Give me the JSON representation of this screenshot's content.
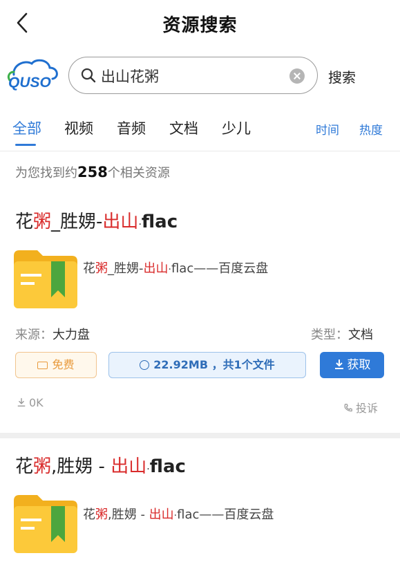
{
  "header": {
    "title": "资源搜索"
  },
  "search": {
    "value": "出山花粥",
    "button": "搜索",
    "logo": "QUSO"
  },
  "tabs": [
    {
      "label": "全部",
      "active": true
    },
    {
      "label": "视频"
    },
    {
      "label": "音频"
    },
    {
      "label": "文档"
    },
    {
      "label": "少儿"
    }
  ],
  "sort": {
    "time": "时间",
    "hot": "热度"
  },
  "results_count": {
    "prefix": "为您找到约",
    "number": "258",
    "suffix": "个相关资源"
  },
  "results": [
    {
      "title_parts": [
        "花",
        "粥",
        "_胜娚-",
        "出山",
        "·",
        "flac"
      ],
      "desc_parts": [
        "花",
        "粥",
        "_胜娚-",
        "出山",
        "·",
        "flac——百度云盘"
      ],
      "source_label": "来源：",
      "source": "大力盘",
      "type_label": "类型：",
      "type": "文档",
      "free": "免费",
      "size_info": "22.92MB ，共1个文件",
      "get": "获取",
      "downloads": "0K",
      "report": "投诉"
    },
    {
      "title_parts": [
        "花",
        "粥",
        ",胜娚 - ",
        "出山",
        "·",
        "flac"
      ],
      "desc_parts": [
        "花",
        "粥",
        ",胜娚 - ",
        "出山",
        "·",
        "flac——百度云盘"
      ]
    }
  ],
  "colors": {
    "accent": "#2f7ad8",
    "highlight": "#d92b2b",
    "free": "#e89a3c"
  }
}
